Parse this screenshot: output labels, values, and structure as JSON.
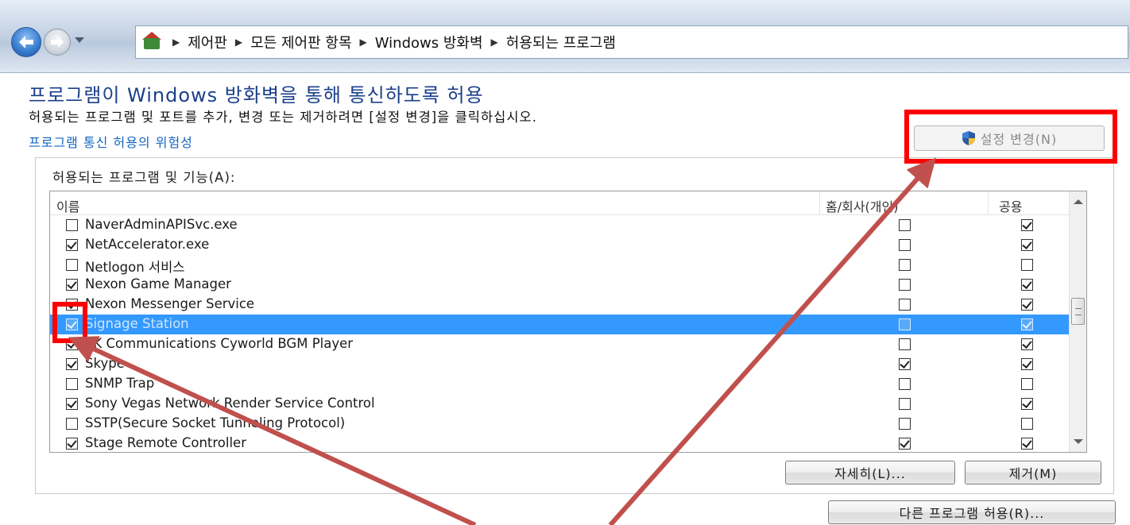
{
  "address_bar": {
    "crumbs": [
      "제어판",
      "모든 제어판 항목",
      "Windows 방화벽",
      "허용되는 프로그램"
    ]
  },
  "header": {
    "title": "프로그램이 Windows 방화벽을 통해 통신하도록 허용",
    "description": "허용되는 프로그램 및 포트를 추가, 변경 또는 제거하려면 [설정 변경]을 클릭하십시오.",
    "risk_link": "프로그램 통신 허용의 위험성",
    "change_settings_label": "설정 변경(N)"
  },
  "list": {
    "group_label": "허용되는 프로그램 및 기능(A):",
    "columns": {
      "name": "이름",
      "home": "홈/회사(개인)",
      "public": "공용"
    },
    "rows": [
      {
        "name": "NaverAdminAPISvc.exe",
        "enabled": false,
        "home": false,
        "public": true,
        "selected": false
      },
      {
        "name": "NetAccelerator.exe",
        "enabled": true,
        "home": false,
        "public": true,
        "selected": false
      },
      {
        "name": "Netlogon 서비스",
        "enabled": false,
        "home": false,
        "public": false,
        "selected": false
      },
      {
        "name": "Nexon Game Manager",
        "enabled": true,
        "home": false,
        "public": true,
        "selected": false
      },
      {
        "name": "Nexon Messenger Service",
        "enabled": true,
        "home": false,
        "public": true,
        "selected": false
      },
      {
        "name": "Signage Station",
        "enabled": true,
        "home": false,
        "public": true,
        "selected": true
      },
      {
        "name": "SK Communications Cyworld BGM Player",
        "enabled": true,
        "home": false,
        "public": true,
        "selected": false
      },
      {
        "name": "Skype",
        "enabled": true,
        "home": true,
        "public": true,
        "selected": false
      },
      {
        "name": "SNMP Trap",
        "enabled": false,
        "home": false,
        "public": false,
        "selected": false
      },
      {
        "name": "Sony Vegas Network Render Service Control",
        "enabled": true,
        "home": false,
        "public": true,
        "selected": false
      },
      {
        "name": "SSTP(Secure Socket Tunneling Protocol)",
        "enabled": false,
        "home": false,
        "public": false,
        "selected": false
      },
      {
        "name": "Stage Remote Controller",
        "enabled": true,
        "home": true,
        "public": true,
        "selected": false
      }
    ]
  },
  "buttons": {
    "details": "자세히(L)...",
    "remove": "제거(M)",
    "allow_other": "다른 프로그램 허용(R)..."
  },
  "colors": {
    "highlight": "#ff0000",
    "annotation_arrow": "#c0504d",
    "selection": "#3399ff",
    "title": "#1b3f8a"
  }
}
